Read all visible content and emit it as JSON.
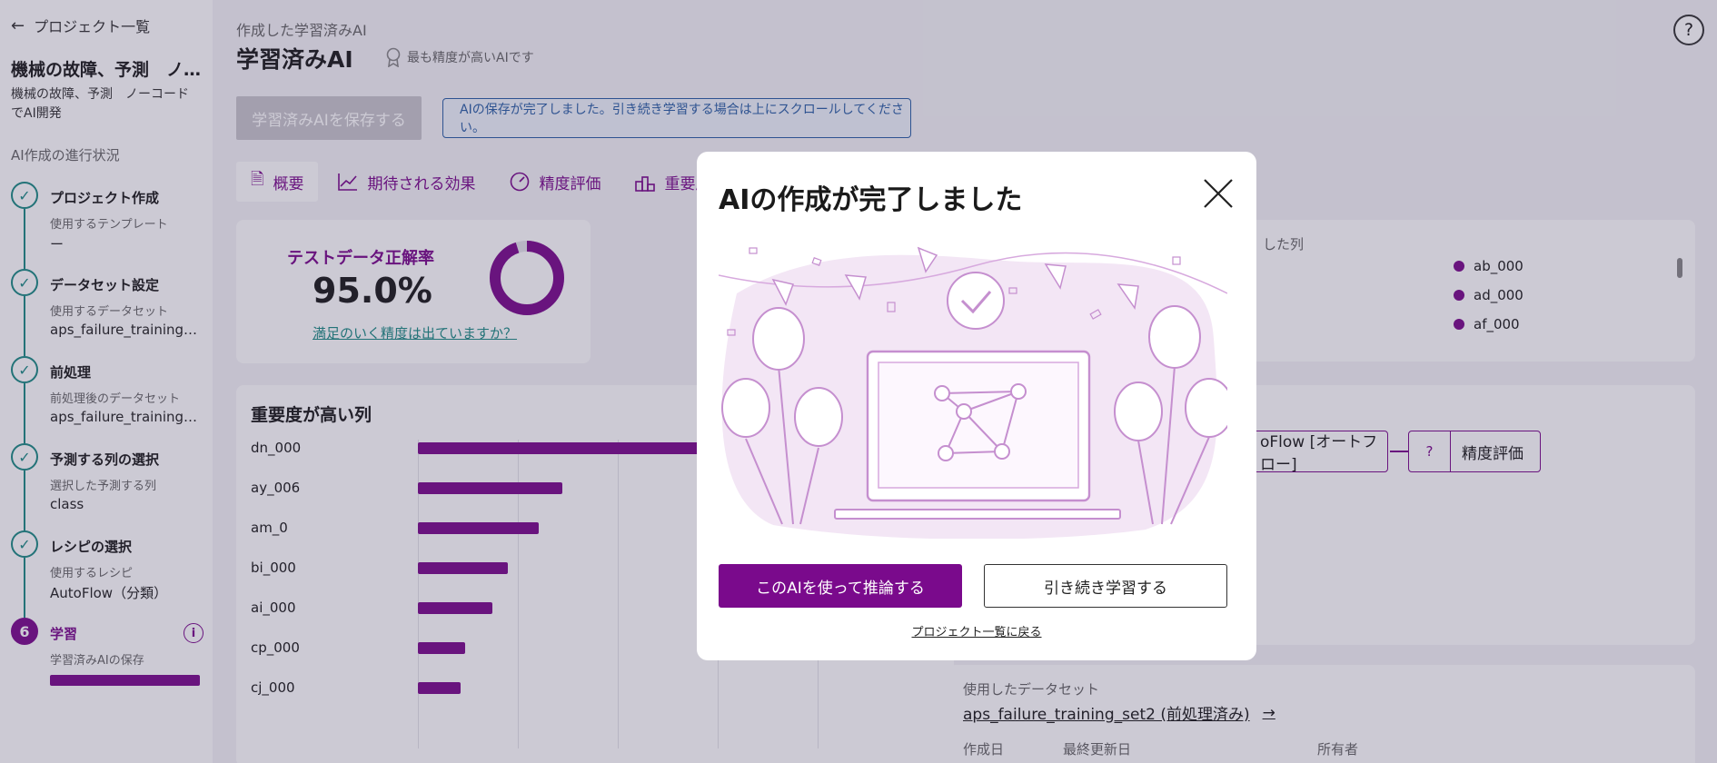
{
  "sidebar": {
    "back_label": "プロジェクト一覧",
    "project_title": "機械の故障、予測　ノ…",
    "project_desc": "機械の故障、予測　ノーコードでAI開発",
    "progress_label": "AI作成の進行状況",
    "steps": [
      {
        "title": "プロジェクト作成",
        "sub": "使用するテンプレート",
        "value": "ー"
      },
      {
        "title": "データセット設定",
        "sub": "使用するデータセット",
        "value": "aps_failure_training_..."
      },
      {
        "title": "前処理",
        "sub": "前処理後のデータセット",
        "value": "aps_failure_training_..."
      },
      {
        "title": "予測する列の選択",
        "sub": "選択した予測する列",
        "value": "class"
      },
      {
        "title": "レシピの選択",
        "sub": "使用するレシピ",
        "value": "AutoFlow（分類）"
      },
      {
        "number": "6",
        "title": "学習",
        "sub": "学習済みAIの保存",
        "value": "",
        "progress": 1.0
      }
    ]
  },
  "main": {
    "crumb": "作成した学習済みAI",
    "title": "学習済みAI",
    "best_label": "最も精度が高いAIです",
    "save_label": "学習済みAIを保存する",
    "notice": "AIの保存が完了しました。引き続き学習する場合は上にスクロールしてください。",
    "help": "?",
    "tabs": [
      {
        "label": "概要",
        "icon": "document-icon"
      },
      {
        "label": "期待される効果",
        "icon": "line-chart-icon"
      },
      {
        "label": "精度評価",
        "icon": "gauge-icon"
      },
      {
        "label": "重要度",
        "icon": "podium-icon"
      }
    ],
    "accuracy": {
      "label": "テストデータ正解率",
      "value": "95.0%",
      "fraction": 0.95,
      "link": "満足のいく精度は出ていますか？"
    },
    "importance": {
      "title": "重要度が高い列",
      "rows": [
        {
          "name": "dn_000",
          "value": 1.0
        },
        {
          "name": "ay_006",
          "value": 0.37
        },
        {
          "name": "am_0",
          "value": 0.31
        },
        {
          "name": "bi_000",
          "value": 0.23
        },
        {
          "name": "ai_000",
          "value": 0.19
        },
        {
          "name": "cp_000",
          "value": 0.12
        },
        {
          "name": "cj_000",
          "value": 0.11
        }
      ]
    },
    "columns": {
      "head": "した列",
      "items": [
        "ab_000",
        "ad_000",
        "af_000"
      ]
    },
    "flow": {
      "box_a": "oFlow [オートフロー]",
      "box_b_q": "?",
      "box_b": "精度評価"
    },
    "dataset": {
      "head": "使用したデータセット",
      "name": "aps_failure_training_set2 (前処理済み)",
      "arrow": "→",
      "meta": [
        "作成日",
        "最終更新日",
        "所有者"
      ]
    }
  },
  "modal": {
    "title": "AIの作成が完了しました",
    "primary": "このAIを使って推論する",
    "secondary": "引き続き学習する",
    "link": "プロジェクト一覧に戻る"
  },
  "colors": {
    "accent": "#7a0a8c",
    "done": "#1b8a84",
    "notice": "#2b5fa5",
    "illus_light": "#f3e6f5",
    "illus_line": "#d7a9de"
  }
}
